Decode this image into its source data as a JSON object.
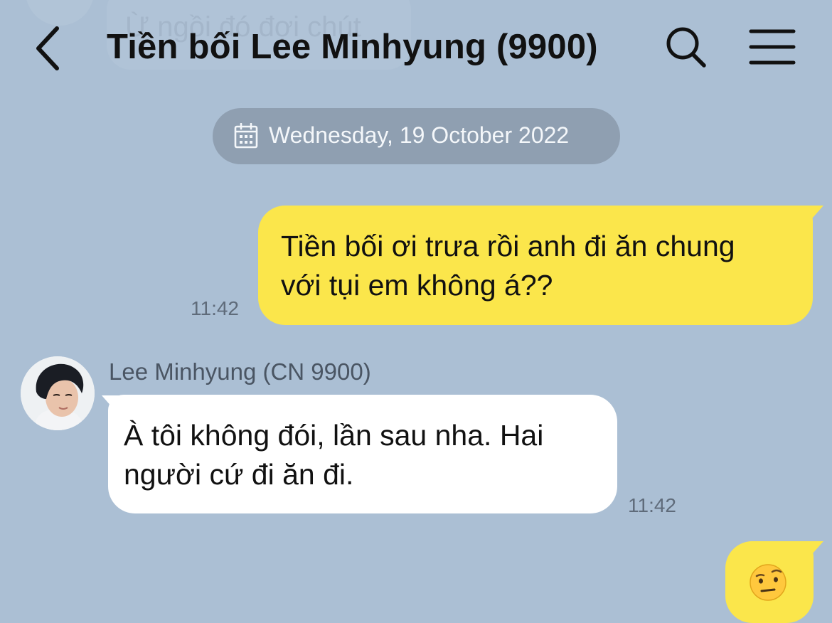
{
  "header": {
    "title": "Tiền bối Lee Minhyung (9900)",
    "back_icon": "chevron-left-icon",
    "search_icon": "search-icon",
    "menu_icon": "menu-icon"
  },
  "background_message": {
    "text": "Ừ ngồi đó đợi chút"
  },
  "date_separator": {
    "icon": "calendar-icon",
    "text": "Wednesday, 19 October 2022"
  },
  "messages": [
    {
      "direction": "sent",
      "lines": [
        "Tiền bối ơi trưa rồi anh đi ăn chung",
        "với tụi em không á??"
      ],
      "time": "11:42",
      "bubble_color": "#fbe64b"
    },
    {
      "direction": "received",
      "sender": "Lee Minhyung (CN 9900)",
      "lines": [
        "À tôi không đói, lần sau nha. Hai",
        "người cứ đi ăn đi."
      ],
      "time": "11:42",
      "bubble_color": "#ffffff"
    },
    {
      "direction": "sent",
      "emoji": "face-with-raised-eyebrow",
      "bubble_color": "#fbe64b"
    }
  ],
  "colors": {
    "background": "#abbfd4",
    "sent_bubble": "#fbe64b",
    "received_bubble": "#ffffff",
    "date_pill": "#8f9fb1",
    "time_text": "#5f6b7a"
  }
}
